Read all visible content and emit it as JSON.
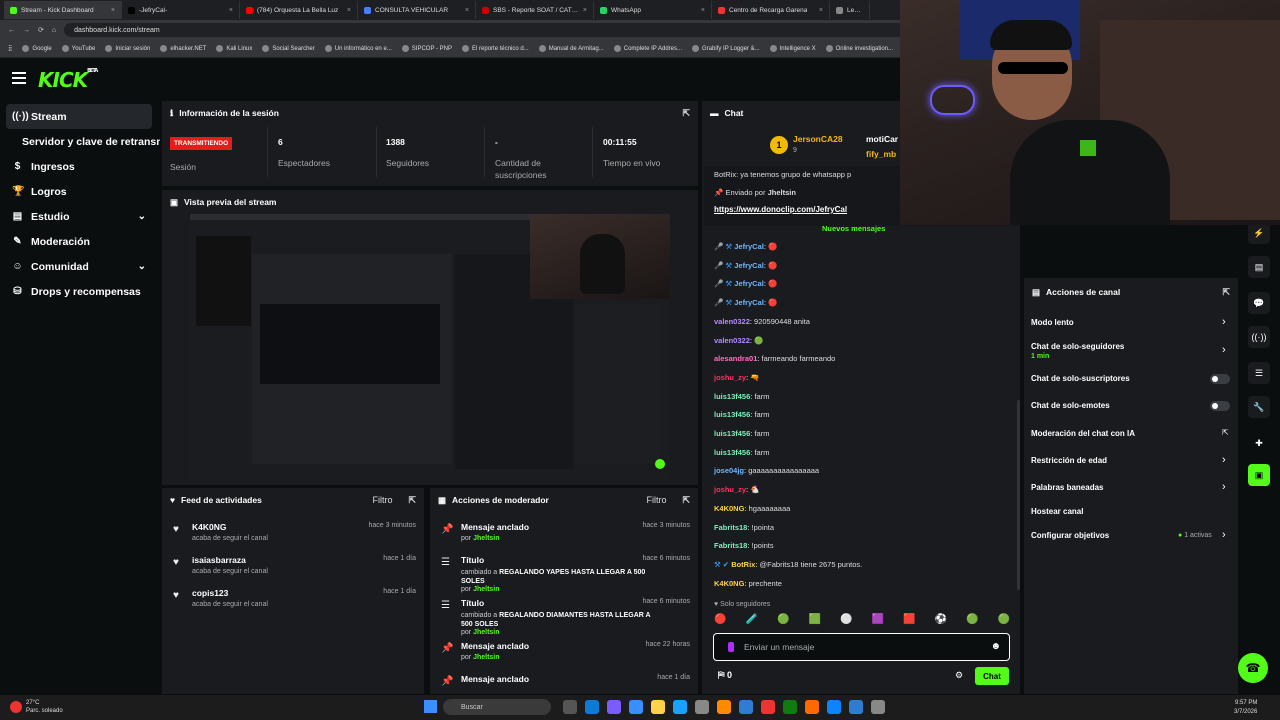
{
  "browser": {
    "tabs": [
      {
        "label": "Stream - Kick Dashboard",
        "color": "#53fc18",
        "active": true
      },
      {
        "label": "-JefryCal-",
        "color": "#000"
      },
      {
        "label": "(784) Orquesta La Bella Luz",
        "color": "#ff0000"
      },
      {
        "label": "CONSULTA VEHICULAR",
        "color": "#4a7cff"
      },
      {
        "label": "SBS - Reporte SOAT / CAT y Se",
        "color": "#c00"
      },
      {
        "label": "WhatsApp",
        "color": "#25d366"
      },
      {
        "label": "Centro de Recarga Garena",
        "color": "#e33"
      },
      {
        "label": "Lealtad | El r",
        "color": "#888"
      }
    ],
    "url": "dashboard.kick.com/stream",
    "bookmarks": [
      "Google",
      "YouTube",
      "Iniciar sesión",
      "elhacker.NET",
      "Kali Linux",
      "Social Searcher",
      "Un informático en e...",
      "SIPCOP - PNP",
      "El reporte técnico d...",
      "Manual de Armitag...",
      "Complete IP Addres...",
      "Grabify IP Logger &...",
      "Intelligence X",
      "Online investigation..."
    ]
  },
  "logo": {
    "text": "KICK",
    "beta": "BETA"
  },
  "sidebar": [
    {
      "label": "Stream",
      "icon": "((·))",
      "active": true
    },
    {
      "label": "Servidor y clave de retransmisión",
      "sub": true
    },
    {
      "label": "Ingresos",
      "icon": "$"
    },
    {
      "label": "Logros",
      "icon": "🏆"
    },
    {
      "label": "Estudio",
      "icon": "▤",
      "chevron": true
    },
    {
      "label": "Moderación",
      "icon": "✎"
    },
    {
      "label": "Comunidad",
      "icon": "☺",
      "chevron": true
    },
    {
      "label": "Drops y recompensas",
      "icon": "⛁"
    }
  ],
  "info": {
    "title": "Información de la sesión",
    "status": "TRANSMITIENDO",
    "status_label": "Sesión",
    "stats": [
      {
        "value": "6",
        "label": "Espectadores"
      },
      {
        "value": "1388",
        "label": "Seguidores"
      },
      {
        "value": "-",
        "label": "Cantidad de suscripciones"
      },
      {
        "value": "00:11:55",
        "label": "Tiempo en vivo"
      }
    ]
  },
  "preview": {
    "title": "Vista previa del stream"
  },
  "feed": {
    "title": "Feed de actividades",
    "filter": "Filtro",
    "items": [
      {
        "name": "K4K0NG",
        "desc": "acaba de seguir el canal",
        "time": "hace 3 minutos"
      },
      {
        "name": "isaiasbarraza",
        "desc": "acaba de seguir el canal",
        "time": "hace 1 día"
      },
      {
        "name": "copis123",
        "desc": "acaba de seguir el canal",
        "time": "hace 1 día"
      }
    ]
  },
  "modactions": {
    "title": "Acciones de moderador",
    "filter": "Filtro",
    "items": [
      {
        "title": "Mensaje anclado",
        "line1": "por",
        "by": "Jheltsin",
        "time": "hace 3 minutos"
      },
      {
        "title": "Título",
        "line1": "cambiado a",
        "bold": "REGALANDO YAPES HASTA LLEGAR A 500 SOLES",
        "by": "Jheltsin",
        "time": "hace 6 minutos"
      },
      {
        "title": "Título",
        "line1": "cambiado a",
        "bold": "REGALANDO DIAMANTES HASTA LLEGAR A 500 SOLES",
        "by": "Jheltsin",
        "time": "hace 6 minutos"
      },
      {
        "title": "Mensaje anclado",
        "line1": "por",
        "by": "Jheltsin",
        "time": "hace 22 horas"
      },
      {
        "title": "Mensaje anclado",
        "line1": "por",
        "by": "",
        "time": "hace 1 día"
      }
    ]
  },
  "chat": {
    "title": "Chat",
    "top": [
      {
        "name": "JersonCA28",
        "sub": "9"
      },
      {
        "name": "motiCar"
      },
      {
        "name": "fify_mb"
      }
    ],
    "pinned": {
      "partial": "BotRix: ya tenemos grupo de whatsapp p",
      "sent_by_label": "Enviado por",
      "sent_by": "Jheltsin",
      "link": "https://www.donoclip.com/JefryCal"
    },
    "new_label": "Nuevos mensajes",
    "messages": [
      {
        "user": "JefryCal",
        "color": "#6fb7ff",
        "text": "",
        "icon": "🔴"
      },
      {
        "user": "JefryCal",
        "color": "#6fb7ff",
        "text": "",
        "icon": "🔴"
      },
      {
        "user": "JefryCal",
        "color": "#6fb7ff",
        "text": "",
        "icon": "🔴"
      },
      {
        "user": "JefryCal",
        "color": "#6fb7ff",
        "text": "",
        "icon": "🔴"
      },
      {
        "user": "valen0322",
        "color": "#b48cff",
        "text": "920590448 anita"
      },
      {
        "user": "valen0322",
        "color": "#b48cff",
        "text": "",
        "icon": "🟢"
      },
      {
        "user": "alesandra01",
        "color": "#ff6ec7",
        "text": "farmeando farmeando"
      },
      {
        "user": "joshu_zy",
        "color": "#ff2e63",
        "text": "",
        "icon": "🔫"
      },
      {
        "user": "luis13f456",
        "color": "#7ef0b8",
        "text": "farm"
      },
      {
        "user": "luis13f456",
        "color": "#7ef0b8",
        "text": "farm"
      },
      {
        "user": "luis13f456",
        "color": "#7ef0b8",
        "text": "farm"
      },
      {
        "user": "luis13f456",
        "color": "#7ef0b8",
        "text": "farm"
      },
      {
        "user": "jose04jg",
        "color": "#6fb7ff",
        "text": "gaaaaaaaaaaaaaaaa"
      },
      {
        "user": "joshu_zy",
        "color": "#ff2e63",
        "text": "",
        "icon": "🐔"
      },
      {
        "user": "K4K0NG",
        "color": "#ffd24a",
        "text": "hgaaaaaaaa"
      },
      {
        "user": "Fabrits18",
        "color": "#7ef0b8",
        "text": "!pointa"
      },
      {
        "user": "Fabrits18",
        "color": "#7ef0b8",
        "text": "!points"
      },
      {
        "user": "BotRix",
        "color": "#ffd24a",
        "text": "@Fabrits18 tiene 2675 puntos."
      },
      {
        "user": "K4K0NG",
        "color": "#ffd24a",
        "text": "prechente"
      }
    ],
    "followers_only": "Solo seguidores",
    "placeholder": "Enviar un mensaje",
    "count": "0",
    "send": "Chat"
  },
  "canal": {
    "title": "Acciones de canal",
    "items": [
      {
        "label": "Modo lento",
        "type": "arrow"
      },
      {
        "label": "Chat de solo-seguidores",
        "sub": "1 min",
        "type": "arrow"
      },
      {
        "label": "Chat de solo-suscriptores",
        "type": "toggle"
      },
      {
        "label": "Chat de solo-emotes",
        "type": "toggle"
      },
      {
        "label": "Moderación del chat con IA",
        "type": "ext"
      },
      {
        "label": "Restricción de edad",
        "type": "arrow"
      },
      {
        "label": "Palabras baneadas",
        "type": "arrow"
      },
      {
        "label": "Hostear canal",
        "type": "none"
      },
      {
        "label": "Configurar objetivos",
        "type": "arrow",
        "extra": "1 activas"
      }
    ]
  },
  "taskbar": {
    "weather_temp": "27°C",
    "weather_desc": "Parc. soleado",
    "search": "Buscar",
    "time": "9:57 PM",
    "date": "3/7/2026"
  }
}
